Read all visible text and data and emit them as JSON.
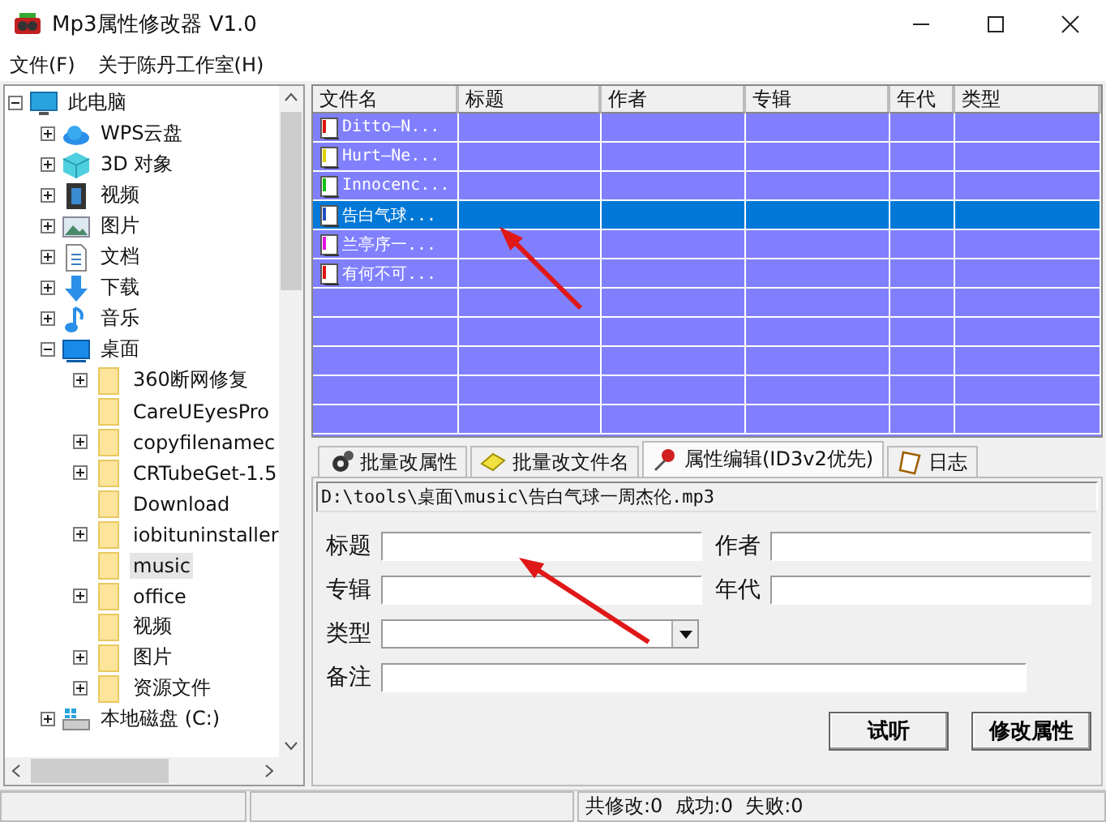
{
  "window": {
    "title": "Mp3属性修改器 V1.0"
  },
  "menu": [
    "文件(F)",
    "关于陈丹工作室(H)"
  ],
  "tree": [
    {
      "label": "此电脑",
      "kind": "computer",
      "expandable": true,
      "expanded": true,
      "selected": false,
      "children": [
        {
          "label": "WPS云盘",
          "kind": "cloud",
          "expandable": true,
          "expanded": false,
          "selected": false
        },
        {
          "label": "3D 对象",
          "kind": "cube",
          "expandable": true,
          "expanded": false,
          "selected": false
        },
        {
          "label": "视频",
          "kind": "film",
          "expandable": true,
          "expanded": false,
          "selected": false
        },
        {
          "label": "图片",
          "kind": "picture",
          "expandable": true,
          "expanded": false,
          "selected": false
        },
        {
          "label": "文档",
          "kind": "document",
          "expandable": true,
          "expanded": false,
          "selected": false
        },
        {
          "label": "下载",
          "kind": "download",
          "expandable": true,
          "expanded": false,
          "selected": false
        },
        {
          "label": "音乐",
          "kind": "music",
          "expandable": true,
          "expanded": false,
          "selected": false
        },
        {
          "label": "桌面",
          "kind": "desktop",
          "expandable": true,
          "expanded": true,
          "selected": false,
          "children": [
            {
              "label": "360断网修复",
              "kind": "folder",
              "expandable": true,
              "expanded": false,
              "selected": false
            },
            {
              "label": "CareUEyesPro",
              "kind": "folder",
              "expandable": false,
              "selected": false
            },
            {
              "label": "copyfilenamec",
              "kind": "folder",
              "expandable": true,
              "expanded": false,
              "selected": false
            },
            {
              "label": "CRTubeGet-1.5",
              "kind": "folder",
              "expandable": true,
              "expanded": false,
              "selected": false
            },
            {
              "label": "Download",
              "kind": "folder",
              "expandable": false,
              "selected": false
            },
            {
              "label": "iobituninstaller",
              "kind": "folder",
              "expandable": true,
              "expanded": false,
              "selected": false
            },
            {
              "label": "music",
              "kind": "folder",
              "expandable": false,
              "selected": true
            },
            {
              "label": "office",
              "kind": "folder",
              "expandable": true,
              "expanded": false,
              "selected": false
            },
            {
              "label": "视频",
              "kind": "folder",
              "expandable": false,
              "selected": false
            },
            {
              "label": "图片",
              "kind": "folder",
              "expandable": true,
              "expanded": false,
              "selected": false
            },
            {
              "label": "资源文件",
              "kind": "folder",
              "expandable": true,
              "expanded": false,
              "selected": false
            }
          ]
        },
        {
          "label": "本地磁盘 (C:)",
          "kind": "drive",
          "expandable": true,
          "expanded": false,
          "selected": false
        }
      ]
    }
  ],
  "table": {
    "columns": [
      "文件名",
      "标题",
      "作者",
      "专辑",
      "年代",
      "类型"
    ],
    "rows": [
      {
        "file": "Ditto—N...",
        "color": "#e01010",
        "selected": false
      },
      {
        "file": "Hurt—Ne...",
        "color": "#e0d000",
        "selected": false
      },
      {
        "file": "Innocenc...",
        "color": "#10c010",
        "selected": false
      },
      {
        "file": "告白气球...",
        "color": "#2050c0",
        "selected": true
      },
      {
        "file": "兰亭序一...",
        "color": "#e010e0",
        "selected": false
      },
      {
        "file": "有何不可...",
        "color": "#e01010",
        "selected": false
      }
    ]
  },
  "tabs": [
    {
      "label": "批量改属性",
      "kind": "gears",
      "selected": false
    },
    {
      "label": "批量改文件名",
      "kind": "eraser",
      "selected": false
    },
    {
      "label": "属性编辑(ID3v2优先)",
      "kind": "pin",
      "selected": true
    },
    {
      "label": "日志",
      "kind": "note",
      "selected": false
    }
  ],
  "path": "D:\\tools\\桌面\\music\\告白气球一周杰伦.mp3",
  "form": [
    {
      "label": "标题",
      "kind": "text"
    },
    {
      "label": "作者",
      "kind": "text"
    },
    {
      "label": "专辑",
      "kind": "text"
    },
    {
      "label": "年代",
      "kind": "text"
    },
    {
      "label": "类型",
      "kind": "select"
    },
    {
      "label": "备注",
      "kind": "wide"
    }
  ],
  "buttons": [
    "试听",
    "修改属性"
  ],
  "status_bar": "共修改:0  成功:0  失败:0",
  "annotations": [
    {
      "kind": "arrow"
    },
    {
      "kind": "arrow"
    }
  ]
}
